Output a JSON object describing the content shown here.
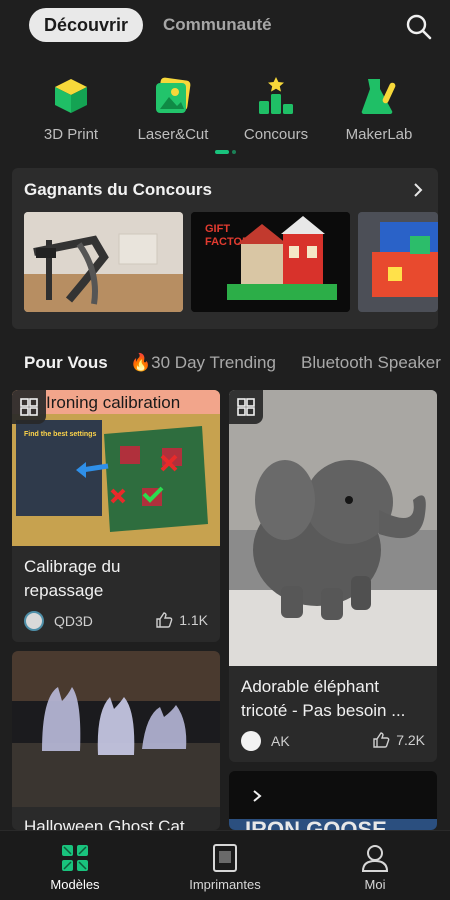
{
  "header": {
    "tab_active": "Découvrir",
    "tab_inactive": "Communauté"
  },
  "categories": [
    {
      "label": "3D Print",
      "icon": "cube-icon"
    },
    {
      "label": "Laser&Cut",
      "icon": "image-icon"
    },
    {
      "label": "Concours",
      "icon": "podium-icon"
    },
    {
      "label": "MakerLab",
      "icon": "lab-icon"
    }
  ],
  "contest": {
    "title": "Gagnants du Concours",
    "thumb2_lines": [
      "GIFT",
      "FACTORY"
    ]
  },
  "filters": {
    "active": "Pour Vous",
    "items": [
      "🔥30 Day Trending",
      "Bluetooth Speaker"
    ]
  },
  "cards": [
    {
      "image_text": "Ironing calibration",
      "image_subtext": "Find the best settings",
      "title_lines": [
        "Calibrage du",
        "repassage"
      ],
      "author": "QD3D",
      "likes": "1.1K"
    },
    {
      "title_lines": [
        "Adorable éléphant",
        "tricoté - Pas besoin ..."
      ],
      "author": "AK",
      "likes": "7.2K"
    },
    {
      "title_lines": [
        "Halloween Ghost Cat"
      ]
    },
    {
      "image_text": "IRON GOOSE"
    }
  ],
  "bottom_nav": [
    {
      "label": "Modèles",
      "active": true
    },
    {
      "label": "Imprimantes",
      "active": false
    },
    {
      "label": "Moi",
      "active": false
    }
  ],
  "colors": {
    "accent": "#19c37d",
    "background": "#1f1f1f",
    "card": "#2a2a2a"
  }
}
